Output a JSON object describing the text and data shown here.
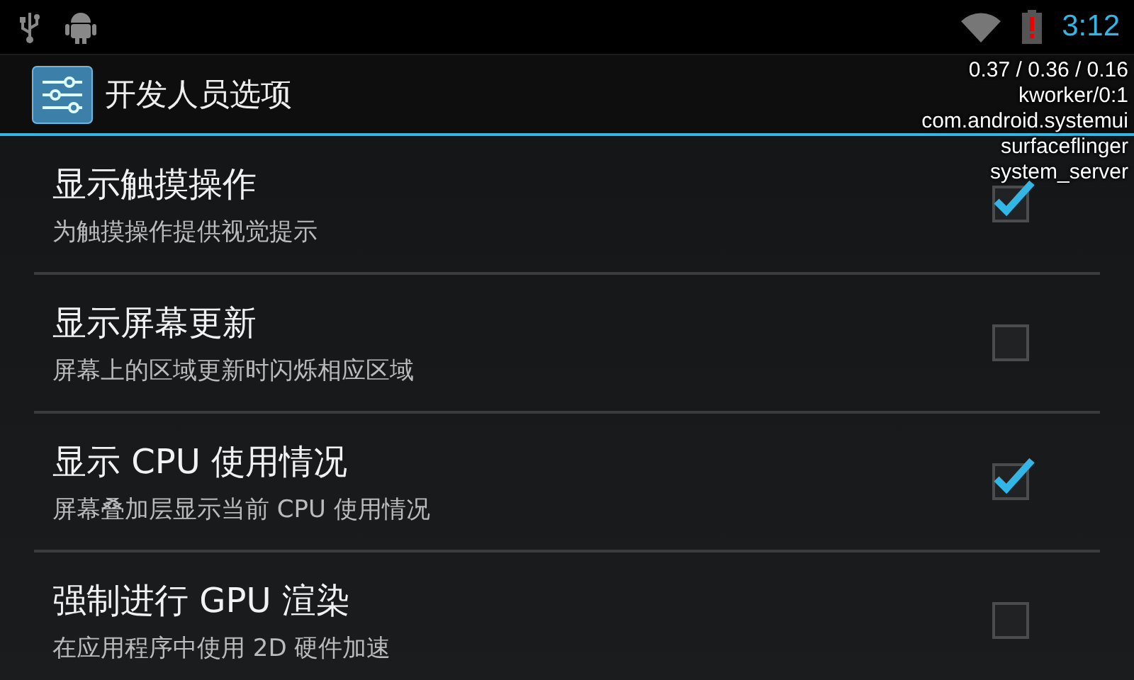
{
  "status_bar": {
    "time": "3:12"
  },
  "action_bar": {
    "title": "开发人员选项"
  },
  "settings": [
    {
      "title": "显示触摸操作",
      "summary": "为触摸操作提供视觉提示",
      "checked": true
    },
    {
      "title": "显示屏幕更新",
      "summary": "屏幕上的区域更新时闪烁相应区域",
      "checked": false
    },
    {
      "title": "显示 CPU 使用情况",
      "summary": "屏幕叠加层显示当前 CPU 使用情况",
      "checked": true
    },
    {
      "title": "强制进行 GPU 渲染",
      "summary": "在应用程序中使用 2D 硬件加速",
      "checked": false
    }
  ],
  "cpu_overlay": {
    "lines": [
      "0.37 / 0.36 / 0.16",
      "kworker/0:1",
      "com.android.systemui",
      "surfaceflinger",
      "system_server"
    ]
  }
}
